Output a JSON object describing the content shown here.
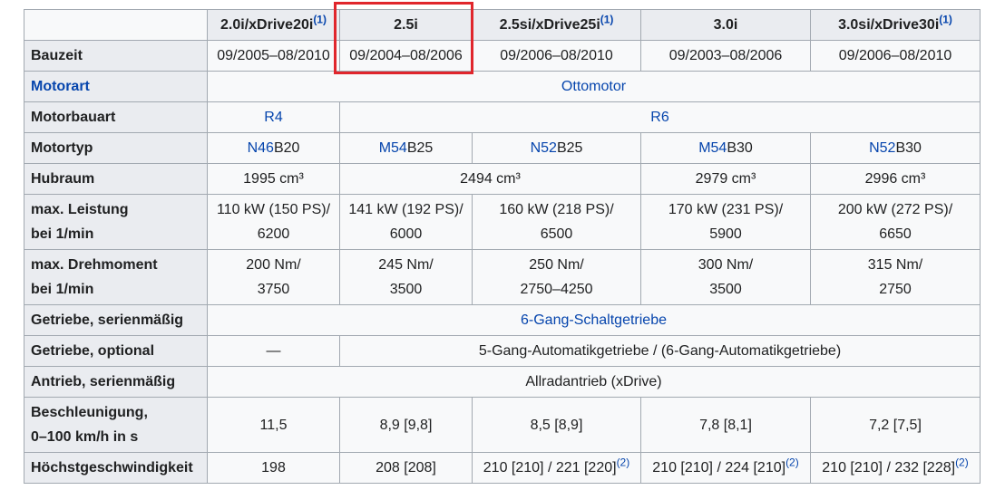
{
  "headers": {
    "c1": {
      "label": "2.0i/xDrive20i",
      "note": "(1)"
    },
    "c2": {
      "label": "2.5i"
    },
    "c3": {
      "label": "2.5si/xDrive25i",
      "note": "(1)"
    },
    "c4": {
      "label": "3.0i"
    },
    "c5": {
      "label": "3.0si/xDrive30i",
      "note": "(1)"
    }
  },
  "rows": {
    "bauzeit": {
      "label": "Bauzeit",
      "c1": "09/2005–08/2010",
      "c2": "09/2004–08/2006",
      "c3": "09/2006–08/2010",
      "c4": "09/2003–08/2006",
      "c5": "09/2006–08/2010"
    },
    "motorart": {
      "label": "Motorart",
      "value": "Ottomotor"
    },
    "motorbauart": {
      "label": "Motorbauart",
      "c1": "R4",
      "c2_5": "R6"
    },
    "motortyp": {
      "label": "Motortyp",
      "c1": {
        "link": "N46",
        "rest": "B20"
      },
      "c2": {
        "link": "M54",
        "rest": "B25"
      },
      "c3": {
        "link": "N52",
        "rest": "B25"
      },
      "c4": {
        "link": "M54",
        "rest": "B30"
      },
      "c5": {
        "link": "N52",
        "rest": "B30"
      }
    },
    "hubraum": {
      "label": "Hubraum",
      "c1": "1995 cm³",
      "c2_3": "2494 cm³",
      "c4": "2979 cm³",
      "c5": "2996 cm³"
    },
    "leistung": {
      "label1": "max. Leistung",
      "label2": "bei 1/min",
      "c1": [
        "110 kW (150 PS)/",
        "6200"
      ],
      "c2": [
        "141 kW (192 PS)/",
        "6000"
      ],
      "c3": [
        "160 kW (218 PS)/",
        "6500"
      ],
      "c4": [
        "170 kW (231 PS)/",
        "5900"
      ],
      "c5": [
        "200 kW (272 PS)/",
        "6650"
      ]
    },
    "drehmoment": {
      "label1": "max. Drehmoment",
      "label2": "bei 1/min",
      "c1": [
        "200 Nm/",
        "3750"
      ],
      "c2": [
        "245 Nm/",
        "3500"
      ],
      "c3": [
        "250 Nm/",
        "2750–4250"
      ],
      "c4": [
        "300 Nm/",
        "3500"
      ],
      "c5": [
        "315 Nm/",
        "2750"
      ]
    },
    "getriebe_serie": {
      "label": "Getriebe, serienmäßig",
      "value": "6-Gang-Schaltgetriebe"
    },
    "getriebe_optional": {
      "label": "Getriebe, optional",
      "c1": "—",
      "c2_5": "5-Gang-Automatikgetriebe / (6-Gang-Automatikgetriebe)"
    },
    "antrieb": {
      "label": "Antrieb, serienmäßig",
      "value": "Allradantrieb (xDrive)"
    },
    "beschleunigung": {
      "label1": "Beschleunigung,",
      "label2": "0–100 km/h in s",
      "c1": "11,5",
      "c2": "8,9 [9,8]",
      "c3": "8,5 [8,9]",
      "c4": "7,8 [8,1]",
      "c5": "7,2 [7,5]"
    },
    "hoechst": {
      "label": "Höchstgeschwindigkeit",
      "c1": "198",
      "c2": "208 [208]",
      "c3": "210 [210] / 221 [220]",
      "c3_note": "(2)",
      "c4": "210 [210] / 224 [210]",
      "c4_note": "(2)",
      "c5": "210 [210] / 232 [228]",
      "c5_note": "(2)"
    }
  },
  "highlight_color": "#e0262c",
  "link_color": "#0645ad"
}
